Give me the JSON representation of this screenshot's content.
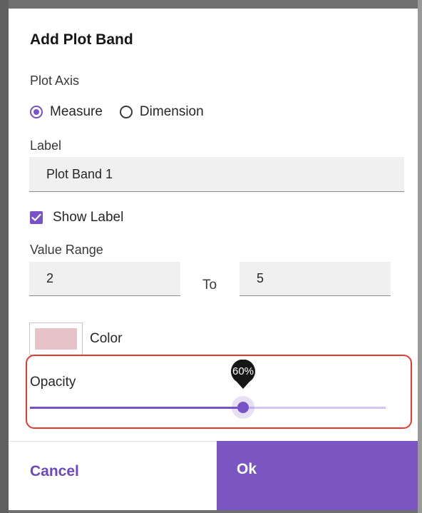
{
  "dialog": {
    "title": "Add Plot Band",
    "plot_axis": {
      "label": "Plot Axis",
      "options": [
        {
          "label": "Measure",
          "checked": true
        },
        {
          "label": "Dimension",
          "checked": false
        }
      ]
    },
    "label_field": {
      "label": "Label",
      "value": "Plot Band 1"
    },
    "show_label": {
      "label": "Show Label",
      "checked": true
    },
    "value_range": {
      "label": "Value Range",
      "from": "2",
      "to_label": "To",
      "to": "5"
    },
    "color": {
      "label": "Color",
      "swatch": "#e5c3c9"
    },
    "opacity": {
      "label": "Opacity",
      "value": 0.6,
      "tooltip": "60%"
    },
    "buttons": {
      "cancel": "Cancel",
      "ok": "Ok"
    }
  },
  "colors": {
    "accent": "#7a52c7",
    "highlight": "#e8392f"
  }
}
